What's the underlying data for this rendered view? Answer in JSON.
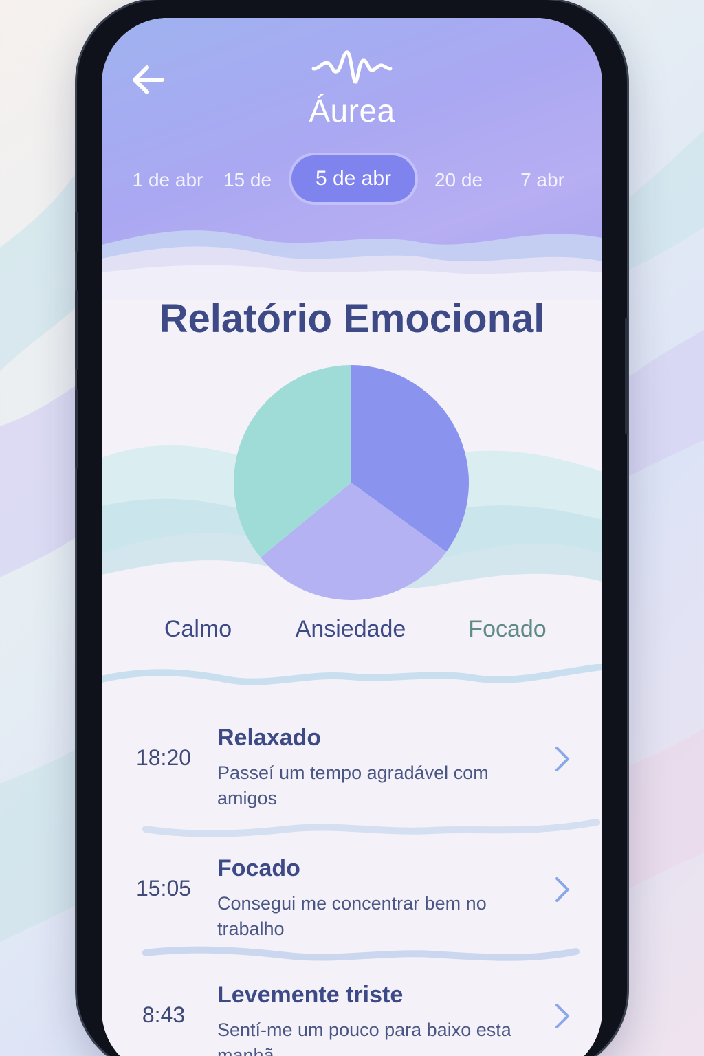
{
  "app": {
    "title": "Áurea"
  },
  "date_tabs": [
    {
      "label": "1 de abr",
      "active": false
    },
    {
      "label": "15 de",
      "active": false
    },
    {
      "label": "5 de abr",
      "active": true
    },
    {
      "label": "20 de",
      "active": false
    },
    {
      "label": "7 abr",
      "active": false
    }
  ],
  "report": {
    "title": "Relatório Emocional"
  },
  "chart_data": {
    "type": "pie",
    "slices": [
      {
        "label": "Calmo",
        "value": 36,
        "color": "#9fdcd8"
      },
      {
        "label": "Ansiedade",
        "value": 29,
        "color": "#b4b2f2"
      },
      {
        "label": "Focado",
        "value": 35,
        "color": "#8a93ee"
      }
    ]
  },
  "legend": [
    {
      "label": "Calmo",
      "color": "#3d4a86"
    },
    {
      "label": "Ansiedade",
      "color": "#3d4a86"
    },
    {
      "label": "Focado",
      "color": "#5f8a87"
    }
  ],
  "entries": [
    {
      "time": "18:20",
      "mood": "Relaxado",
      "note": "Passeí um tempo agradável com amigos"
    },
    {
      "time": "15:05",
      "mood": "Focado",
      "note": "Consegui me concentrar bem no trabalho"
    },
    {
      "time": "8:43",
      "mood": "Levemente triste",
      "note": "Sentí-me um pouco para baixo esta manhã"
    }
  ],
  "icons": {
    "back": "arrow-left-icon",
    "logo": "sound-wave-icon",
    "chevron": "chevron-right-icon"
  }
}
